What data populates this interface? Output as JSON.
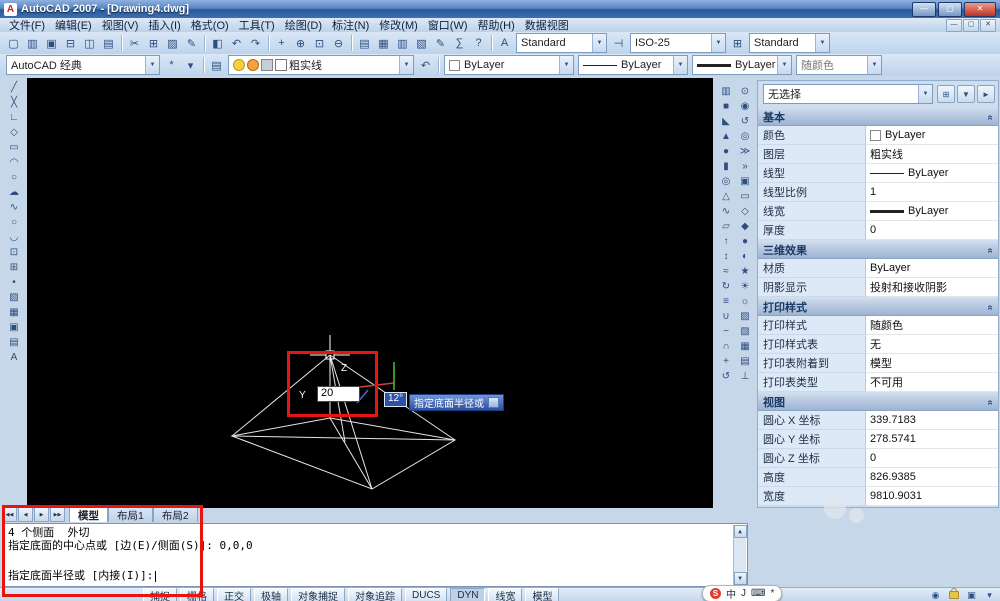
{
  "window": {
    "title": "AutoCAD 2007 - [Drawing4.dwg]"
  },
  "menu": {
    "items": [
      {
        "id": "file",
        "label": "文件(F)"
      },
      {
        "id": "edit",
        "label": "编辑(E)"
      },
      {
        "id": "view",
        "label": "视图(V)"
      },
      {
        "id": "insert",
        "label": "插入(I)"
      },
      {
        "id": "format",
        "label": "格式(O)"
      },
      {
        "id": "tools",
        "label": "工具(T)"
      },
      {
        "id": "draw",
        "label": "绘图(D)"
      },
      {
        "id": "dimension",
        "label": "标注(N)"
      },
      {
        "id": "modify",
        "label": "修改(M)"
      },
      {
        "id": "window",
        "label": "窗口(W)"
      },
      {
        "id": "help",
        "label": "帮助(H)"
      },
      {
        "id": "dataview",
        "label": "数据视图"
      }
    ]
  },
  "toolbar1": {
    "icons": [
      {
        "id": "new",
        "glyph": "▢"
      },
      {
        "id": "open",
        "glyph": "▥"
      },
      {
        "id": "save",
        "glyph": "▣"
      },
      {
        "id": "plot",
        "glyph": "⊟"
      },
      {
        "id": "plot-preview",
        "glyph": "◫"
      },
      {
        "id": "publish",
        "glyph": "▤"
      },
      {
        "id": "cut",
        "glyph": "✂"
      },
      {
        "id": "copy",
        "glyph": "⊞"
      },
      {
        "id": "paste",
        "glyph": "▨"
      },
      {
        "id": "match-properties",
        "glyph": "✎"
      },
      {
        "id": "block-editor",
        "glyph": "◧"
      },
      {
        "id": "undo",
        "glyph": "↶"
      },
      {
        "id": "redo",
        "glyph": "↷"
      },
      {
        "id": "pan",
        "glyph": "+"
      },
      {
        "id": "zoom-realtime",
        "glyph": "⊕"
      },
      {
        "id": "zoom-window",
        "glyph": "⊡"
      },
      {
        "id": "zoom-previous",
        "glyph": "⊖"
      },
      {
        "id": "properties",
        "glyph": "▤"
      },
      {
        "id": "designcenter",
        "glyph": "▦"
      },
      {
        "id": "tool-palettes",
        "glyph": "▥"
      },
      {
        "id": "sheet-set-manager",
        "glyph": "▧"
      },
      {
        "id": "markup-set-manager",
        "glyph": "✎"
      },
      {
        "id": "quickcalc",
        "glyph": "∑"
      },
      {
        "id": "help",
        "glyph": "?"
      }
    ],
    "combos": [
      {
        "id": "text-style",
        "value": "Standard"
      },
      {
        "id": "dim-style",
        "value": "ISO-25"
      },
      {
        "id": "table-style",
        "value": "Standard"
      }
    ]
  },
  "toolbar2": {
    "workspace": "AutoCAD 经典",
    "icons_a": [
      {
        "id": "workspace-settings",
        "glyph": "*"
      },
      {
        "id": "workspace-toolbars",
        "glyph": "▾"
      }
    ],
    "icons_b": [
      {
        "id": "layer-properties-manager",
        "glyph": "▤"
      }
    ],
    "icons_c": [
      {
        "id": "layer-previous",
        "glyph": "↶"
      }
    ],
    "layer": "粗实线",
    "color": "ByLayer",
    "linetype": "ByLayer",
    "lineweight": "ByLayer",
    "plotstyle": "随颜色"
  },
  "draw_toolbar": {
    "icons": [
      {
        "id": "line",
        "glyph": "╱"
      },
      {
        "id": "construction-line",
        "glyph": "╳"
      },
      {
        "id": "polyline",
        "glyph": "∟"
      },
      {
        "id": "polygon",
        "glyph": "◇"
      },
      {
        "id": "rectangle",
        "glyph": "▭"
      },
      {
        "id": "arc",
        "glyph": "◠"
      },
      {
        "id": "circle",
        "glyph": "○"
      },
      {
        "id": "revision-cloud",
        "glyph": "☁"
      },
      {
        "id": "spline",
        "glyph": "∿"
      },
      {
        "id": "ellipse",
        "glyph": "○"
      },
      {
        "id": "ellipse-arc",
        "glyph": "◡"
      },
      {
        "id": "insert-block",
        "glyph": "⊡"
      },
      {
        "id": "make-block",
        "glyph": "⊞"
      },
      {
        "id": "point",
        "glyph": "•"
      },
      {
        "id": "hatch",
        "glyph": "▨"
      },
      {
        "id": "gradient",
        "glyph": "▦"
      },
      {
        "id": "region",
        "glyph": "▣"
      },
      {
        "id": "table",
        "glyph": "▤"
      },
      {
        "id": "multiline-text",
        "glyph": "A"
      }
    ]
  },
  "right_toolbars": {
    "col1": [
      {
        "id": "polysolid",
        "glyph": "▥"
      },
      {
        "id": "box",
        "glyph": "■"
      },
      {
        "id": "wedge",
        "glyph": "◣"
      },
      {
        "id": "cone",
        "glyph": "▲"
      },
      {
        "id": "sphere",
        "glyph": "●"
      },
      {
        "id": "cylinder",
        "glyph": "▮"
      },
      {
        "id": "torus",
        "glyph": "◎"
      },
      {
        "id": "pyramid",
        "glyph": "△"
      },
      {
        "id": "helix",
        "glyph": "∿"
      },
      {
        "id": "planar-surface",
        "glyph": "▱"
      },
      {
        "id": "extrude",
        "glyph": "↑"
      },
      {
        "id": "presspull",
        "glyph": "↕"
      },
      {
        "id": "sweep",
        "glyph": "≈"
      },
      {
        "id": "revolve",
        "glyph": "↻"
      },
      {
        "id": "loft",
        "glyph": "≡"
      },
      {
        "id": "union",
        "glyph": "∪"
      },
      {
        "id": "subtract",
        "glyph": "−"
      },
      {
        "id": "intersect",
        "glyph": "∩"
      },
      {
        "id": "3d-move",
        "glyph": "+"
      },
      {
        "id": "3d-rotate",
        "glyph": "↺"
      }
    ],
    "col2": [
      {
        "id": "constrained-orbit",
        "glyph": "⊙"
      },
      {
        "id": "free-orbit",
        "glyph": "◉"
      },
      {
        "id": "continuous-orbit",
        "glyph": "↺"
      },
      {
        "id": "swivel",
        "glyph": "◎"
      },
      {
        "id": "walk",
        "glyph": "≫"
      },
      {
        "id": "fly",
        "glyph": "»"
      },
      {
        "id": "camera",
        "glyph": "▣"
      },
      {
        "id": "2d-wireframe",
        "glyph": "▭"
      },
      {
        "id": "3d-wireframe",
        "glyph": "◇"
      },
      {
        "id": "3d-hidden",
        "glyph": "◆"
      },
      {
        "id": "realistic",
        "glyph": "●"
      },
      {
        "id": "conceptual",
        "glyph": "◐"
      },
      {
        "id": "render",
        "glyph": "★"
      },
      {
        "id": "lights",
        "glyph": "☀"
      },
      {
        "id": "sun-properties",
        "glyph": "☼"
      },
      {
        "id": "materials",
        "glyph": "▨"
      },
      {
        "id": "mapping",
        "glyph": "▧"
      },
      {
        "id": "background",
        "glyph": "▦"
      },
      {
        "id": "named-views",
        "glyph": "▤"
      },
      {
        "id": "ucs",
        "glyph": "⊥"
      }
    ]
  },
  "canvas": {
    "dyn_value": "20",
    "angle_badge": "12°",
    "tooltip": "指定底面半径或",
    "z_label": "Z",
    "y_label": "Y"
  },
  "properties": {
    "selection": "无选择",
    "palette_buttons": [
      {
        "id": "toggle-pickadd",
        "glyph": "⊞"
      },
      {
        "id": "quick-select",
        "glyph": "▼"
      },
      {
        "id": "select-objects",
        "glyph": "►"
      }
    ],
    "sections": [
      {
        "title": "基本",
        "rows": [
          {
            "label": "颜色",
            "value": "ByLayer",
            "swatch": true
          },
          {
            "label": "图层",
            "value": "粗实线"
          },
          {
            "label": "线型",
            "value": "ByLayer",
            "line": "thin"
          },
          {
            "label": "线型比例",
            "value": "1"
          },
          {
            "label": "线宽",
            "value": "ByLayer",
            "line": "thick"
          },
          {
            "label": "厚度",
            "value": "0"
          }
        ]
      },
      {
        "title": "三维效果",
        "rows": [
          {
            "label": "材质",
            "value": "ByLayer"
          },
          {
            "label": "阴影显示",
            "value": "投射和接收阴影"
          }
        ]
      },
      {
        "title": "打印样式",
        "rows": [
          {
            "label": "打印样式",
            "value": "随颜色"
          },
          {
            "label": "打印样式表",
            "value": "无"
          },
          {
            "label": "打印表附着到",
            "value": "模型"
          },
          {
            "label": "打印表类型",
            "value": "不可用"
          }
        ]
      },
      {
        "title": "视图",
        "rows": [
          {
            "label": "圆心 X 坐标",
            "value": "339.7183"
          },
          {
            "label": "圆心 Y 坐标",
            "value": "278.5741"
          },
          {
            "label": "圆心 Z 坐标",
            "value": "0"
          },
          {
            "label": "高度",
            "value": "826.9385"
          },
          {
            "label": "宽度",
            "value": "9810.9031"
          }
        ]
      }
    ]
  },
  "tabs": {
    "nav": [
      {
        "id": "first-tab",
        "glyph": "◀◀"
      },
      {
        "id": "prev-tab",
        "glyph": "◀"
      },
      {
        "id": "next-tab",
        "glyph": "▶"
      },
      {
        "id": "last-tab",
        "glyph": "▶▶"
      }
    ],
    "items": [
      {
        "id": "model",
        "label": "模型",
        "active": true
      },
      {
        "id": "layout1",
        "label": "布局1",
        "active": false
      },
      {
        "id": "layout2",
        "label": "布局2",
        "active": false
      }
    ]
  },
  "command": {
    "history": [
      "4 个侧面  外切",
      "指定底面的中心点或 [边(E)/侧面(S)]: 0,0,0"
    ],
    "prompt": "指定底面半径或 [内接(I)]:"
  },
  "statusbar": {
    "buttons": [
      {
        "id": "snap",
        "label": "捕捉",
        "pressed": false
      },
      {
        "id": "grid",
        "label": "栅格",
        "pressed": false
      },
      {
        "id": "ortho",
        "label": "正交",
        "pressed": false
      },
      {
        "id": "polar",
        "label": "极轴",
        "pressed": false
      },
      {
        "id": "osnap",
        "label": "对象捕捉",
        "pressed": false
      },
      {
        "id": "otrack",
        "label": "对象追踪",
        "pressed": false
      },
      {
        "id": "ducs",
        "label": "DUCS",
        "pressed": false
      },
      {
        "id": "dyn",
        "label": "DYN",
        "pressed": true
      },
      {
        "id": "lwt",
        "label": "线宽",
        "pressed": false
      },
      {
        "id": "model-space",
        "label": "模型",
        "pressed": false
      }
    ]
  },
  "ime": {
    "items": [
      {
        "id": "sogou-logo",
        "glyph": "S"
      },
      {
        "id": "lang-chinese",
        "glyph": "中"
      },
      {
        "id": "ime-mode",
        "glyph": "J"
      },
      {
        "id": "keyboard-icon",
        "glyph": "⌨"
      },
      {
        "id": "ime-tools-icon",
        "glyph": "*"
      }
    ]
  }
}
